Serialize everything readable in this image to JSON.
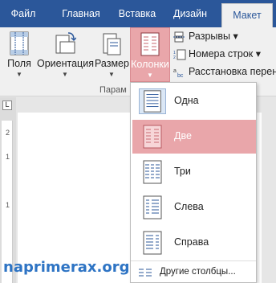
{
  "tabs": [
    {
      "label": "Файл",
      "active": false
    },
    {
      "label": "Главная",
      "active": false
    },
    {
      "label": "Вставка",
      "active": false
    },
    {
      "label": "Дизайн",
      "active": false
    },
    {
      "label": "Макет",
      "active": true
    }
  ],
  "ribbon": {
    "buttons": [
      {
        "label": "Поля",
        "icon": "margins-icon"
      },
      {
        "label": "Ориентация",
        "icon": "orientation-icon"
      },
      {
        "label": "Размер",
        "icon": "size-icon"
      },
      {
        "label": "Колонки",
        "icon": "columns-icon",
        "selected": true
      }
    ],
    "small": [
      {
        "label": "Разрывы ▾",
        "icon": "breaks-icon"
      },
      {
        "label": "Номера строк ▾",
        "icon": "line-numbers-icon"
      },
      {
        "label": "Расстановка перено",
        "icon": "hyphenation-icon"
      }
    ],
    "group_label": "Парам"
  },
  "columns_menu": {
    "items": [
      {
        "label": "Одна",
        "icon": "one-column-icon",
        "current": true
      },
      {
        "label": "Две",
        "icon": "two-columns-icon",
        "hover": true
      },
      {
        "label": "Три",
        "icon": "three-columns-icon"
      },
      {
        "label": "Слева",
        "icon": "left-column-icon"
      },
      {
        "label": "Справа",
        "icon": "right-column-icon"
      }
    ],
    "more_label": "Другие столбцы..."
  },
  "ruler_ticks": [
    "2",
    "1",
    "1"
  ],
  "watermark": "naprimerax.org",
  "colors": {
    "tab_bar": "#2b579a",
    "hover": "#e9a6aa",
    "current": "#dbe7f5",
    "watermark": "#2e74c4"
  }
}
